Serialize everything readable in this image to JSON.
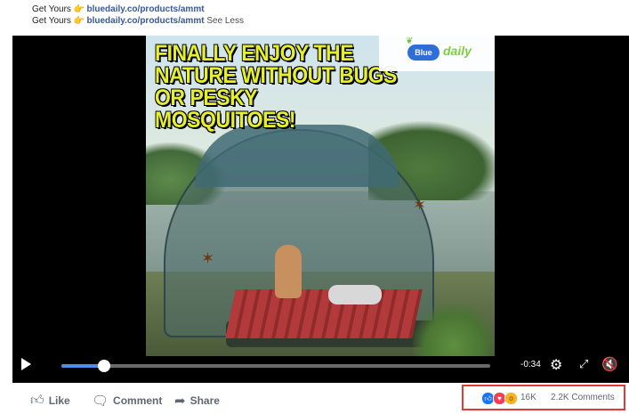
{
  "post": {
    "captions": [
      {
        "prefix": "Get Yours",
        "emoji": "👉",
        "link": "bluedaily.co/products/ammt",
        "suffix": ""
      },
      {
        "prefix": "Get Yours",
        "emoji": "👉",
        "link": "bluedaily.co/products/ammt",
        "suffix": "See Less"
      }
    ]
  },
  "video": {
    "headline": "FINALLY ENJOY THE NATURE WITHOUT BUGS OR PESKY MOSQUITOES!",
    "brand": {
      "pill": "Blue",
      "text": "daily"
    },
    "time_remaining": "-0:34",
    "progress": 0.1,
    "icons": {
      "play": "play-icon",
      "settings": "gear-icon",
      "expand": "expand-icon",
      "volume": "volume-muted-icon"
    }
  },
  "actions": {
    "like": "Like",
    "comment": "Comment",
    "share": "Share"
  },
  "engagement": {
    "reactions": [
      "like",
      "love",
      "wow"
    ],
    "reaction_count": "16K",
    "comments_count": "2.2K Comments"
  },
  "colors": {
    "link": "#385898",
    "headline": "#e6ef2a",
    "progress": "#4a90e2",
    "highlight_border": "#e53935"
  }
}
